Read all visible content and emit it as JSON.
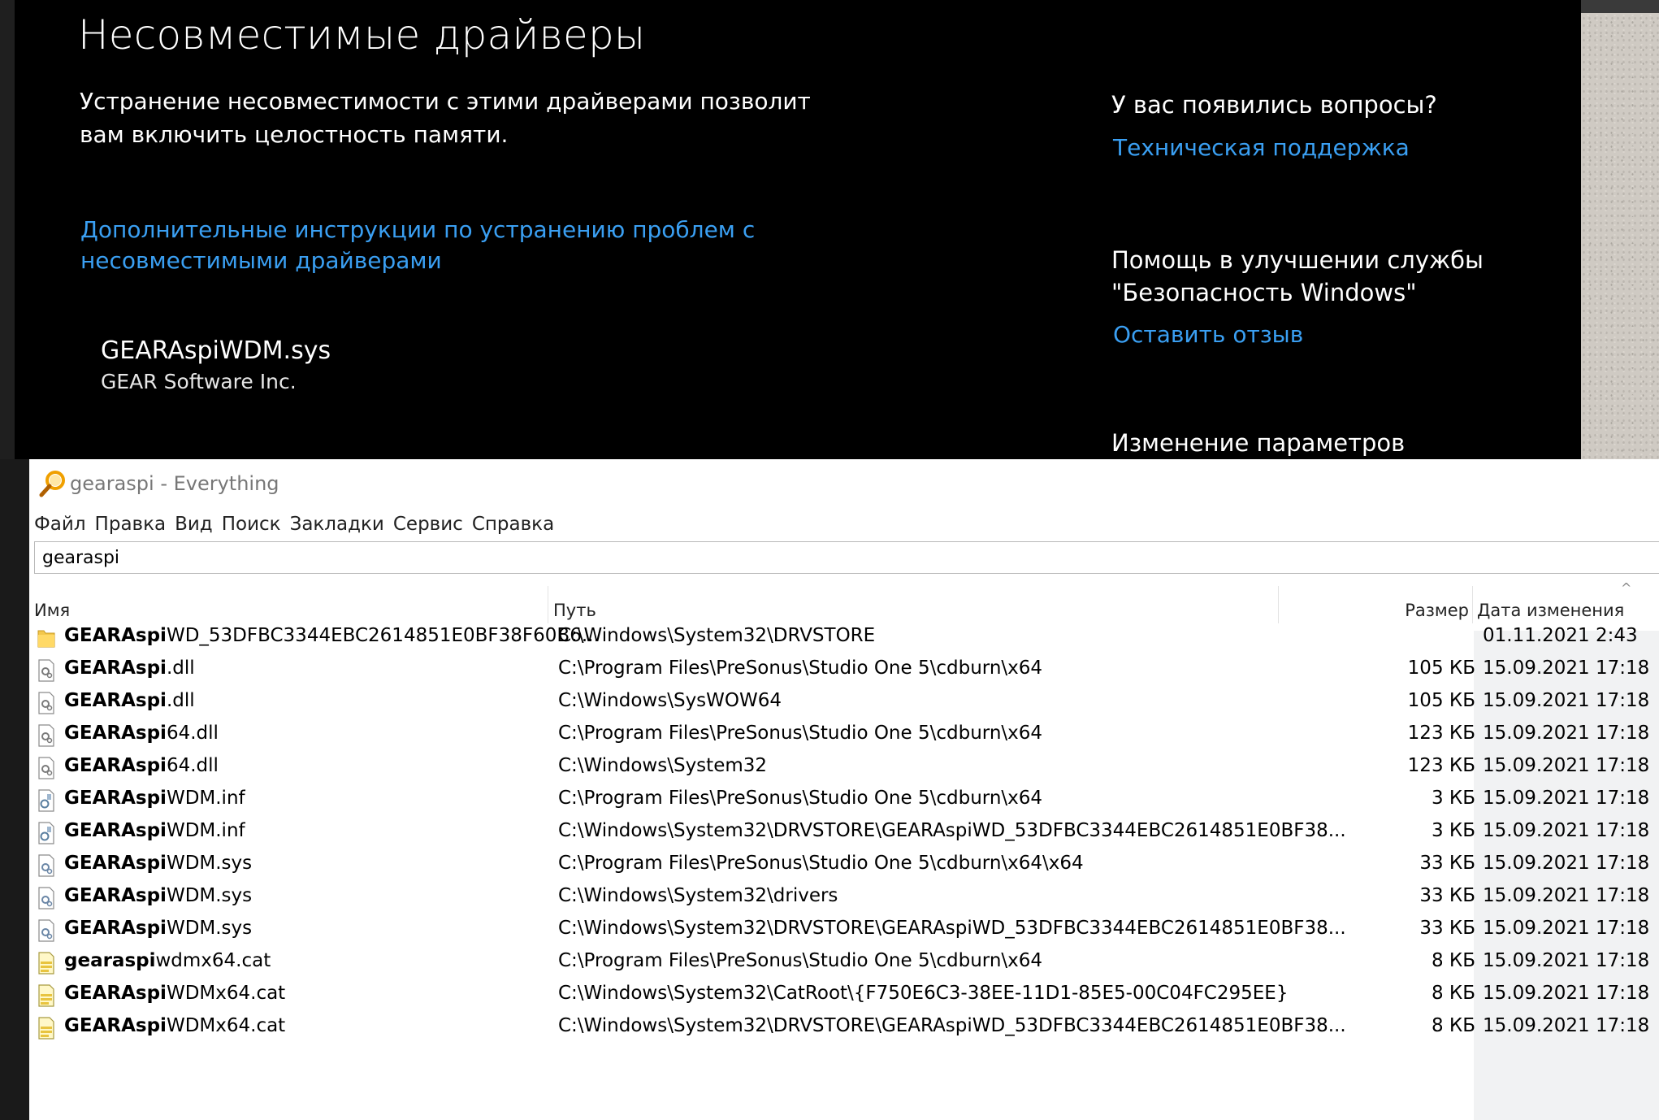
{
  "security": {
    "title": "Несовместимые драйверы",
    "description": "Устранение несовместимости с этими драйверами позволит вам включить целостность памяти.",
    "more_link": "Дополнительные инструкции по устранению проблем с несовместимыми драйверами",
    "driver": {
      "name": "GEARAspiWDM.sys",
      "vendor": "GEAR Software Inc."
    },
    "sidebar": {
      "questions": "У вас появились вопросы?",
      "support_link": "Техническая поддержка",
      "help": "Помощь в улучшении службы \"Безопасность Windows\"",
      "feedback_link": "Оставить отзыв",
      "settings": "Изменение параметров"
    },
    "link_color": "#3a9ff2"
  },
  "everything": {
    "window_title": "gearaspi - Everything",
    "menu": [
      "Файл",
      "Правка",
      "Вид",
      "Поиск",
      "Закладки",
      "Сервис",
      "Справка"
    ],
    "search_value": "gearaspi",
    "columns": {
      "name": "Имя",
      "path": "Путь",
      "size": "Размер",
      "date": "Дата изменения"
    },
    "rows": [
      {
        "icon": "folder-icon",
        "match": "GEARAspi",
        "rest": "WD_53DFBC3344EBC2614851E0BF38F60B6...",
        "path": "C:\\Windows\\System32\\DRVSTORE",
        "size": "",
        "date": "01.11.2021 2:43"
      },
      {
        "icon": "dll-file-icon",
        "match": "GEARAspi",
        "rest": ".dll",
        "path": "C:\\Program Files\\PreSonus\\Studio One 5\\cdburn\\x64",
        "size": "105 КБ",
        "date": "15.09.2021 17:18"
      },
      {
        "icon": "dll-file-icon",
        "match": "GEARAspi",
        "rest": ".dll",
        "path": "C:\\Windows\\SysWOW64",
        "size": "105 КБ",
        "date": "15.09.2021 17:18"
      },
      {
        "icon": "dll-file-icon",
        "match": "GEARAspi",
        "rest": "64.dll",
        "path": "C:\\Program Files\\PreSonus\\Studio One 5\\cdburn\\x64",
        "size": "123 КБ",
        "date": "15.09.2021 17:18"
      },
      {
        "icon": "dll-file-icon",
        "match": "GEARAspi",
        "rest": "64.dll",
        "path": "C:\\Windows\\System32",
        "size": "123 КБ",
        "date": "15.09.2021 17:18"
      },
      {
        "icon": "inf-file-icon",
        "match": "GEARAspi",
        "rest": "WDM.inf",
        "path": "C:\\Program Files\\PreSonus\\Studio One 5\\cdburn\\x64",
        "size": "3 КБ",
        "date": "15.09.2021 17:18"
      },
      {
        "icon": "inf-file-icon",
        "match": "GEARAspi",
        "rest": "WDM.inf",
        "path": "C:\\Windows\\System32\\DRVSTORE\\GEARAspiWD_53DFBC3344EBC2614851E0BF38...",
        "size": "3 КБ",
        "date": "15.09.2021 17:18"
      },
      {
        "icon": "sys-file-icon",
        "match": "GEARAspi",
        "rest": "WDM.sys",
        "path": "C:\\Program Files\\PreSonus\\Studio One 5\\cdburn\\x64\\x64",
        "size": "33 КБ",
        "date": "15.09.2021 17:18"
      },
      {
        "icon": "sys-file-icon",
        "match": "GEARAspi",
        "rest": "WDM.sys",
        "path": "C:\\Windows\\System32\\drivers",
        "size": "33 КБ",
        "date": "15.09.2021 17:18"
      },
      {
        "icon": "sys-file-icon",
        "match": "GEARAspi",
        "rest": "WDM.sys",
        "path": "C:\\Windows\\System32\\DRVSTORE\\GEARAspiWD_53DFBC3344EBC2614851E0BF38...",
        "size": "33 КБ",
        "date": "15.09.2021 17:18"
      },
      {
        "icon": "cat-file-icon",
        "match": "gearaspi",
        "rest": "wdmx64.cat",
        "path": "C:\\Program Files\\PreSonus\\Studio One 5\\cdburn\\x64",
        "size": "8 КБ",
        "date": "15.09.2021 17:18"
      },
      {
        "icon": "cat-file-icon",
        "match": "GEARAspi",
        "rest": "WDMx64.cat",
        "path": "C:\\Windows\\System32\\CatRoot\\{F750E6C3-38EE-11D1-85E5-00C04FC295EE}",
        "size": "8 КБ",
        "date": "15.09.2021 17:18"
      },
      {
        "icon": "cat-file-icon",
        "match": "GEARAspi",
        "rest": "WDMx64.cat",
        "path": "C:\\Windows\\System32\\DRVSTORE\\GEARAspiWD_53DFBC3344EBC2614851E0BF38...",
        "size": "8 КБ",
        "date": "15.09.2021 17:18"
      }
    ]
  }
}
